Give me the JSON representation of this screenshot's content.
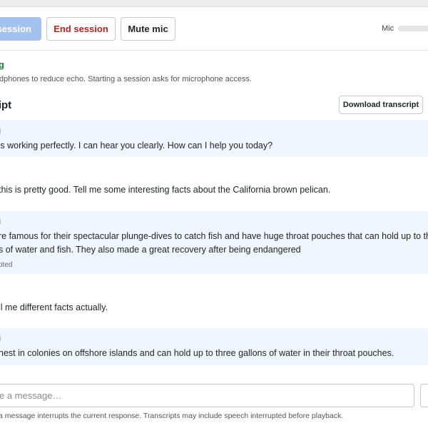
{
  "toolbar": {
    "start_label": "session",
    "end_label": "End session",
    "mute_label": "Mute mic",
    "mic_label": "Mic"
  },
  "status": {
    "text": "ng",
    "hint": "dphones to reduce echo. Starting a session asks for microphone access."
  },
  "transcript": {
    "heading": "ript",
    "download_label": "Download transcript",
    "messages": [
      {
        "speaker": "i",
        "text": "'s working perfectly. I can hear you clearly. How can I help you today?",
        "note": ""
      },
      {
        "speaker": "",
        "text": " this is pretty good. Tell me some interesting facts about the California brown pelican.",
        "note": ""
      },
      {
        "speaker": "i",
        "text_line1": "re famous for their spectacular plunge-dives to catch fish and have huge throat pouches that can hold up to three",
        "text_line2": "s of water and fish. They also made a great recovery after being endangered",
        "note": "pted"
      },
      {
        "speaker": "",
        "text": "ll me different facts actually.",
        "note": ""
      },
      {
        "speaker": "i",
        "text": "nest in colonies on offshore islands and can hold up to three gallons of water in their throat pouches.",
        "note": ""
      }
    ]
  },
  "composer": {
    "placeholder": "e a message…",
    "footnote": "a message interrupts the current response. Transcripts may include speech interrupted before playback."
  }
}
